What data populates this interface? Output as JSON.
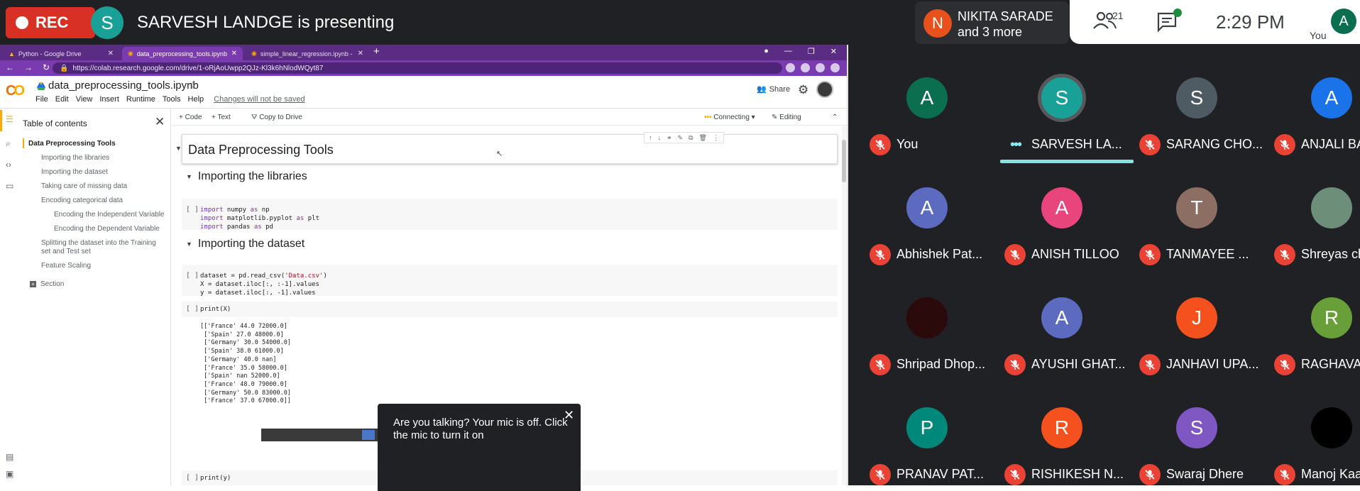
{
  "meet": {
    "rec_label": "REC",
    "presenter_initial": "S",
    "presenting_text": "SARVESH LANDGE is presenting",
    "others_initial": "N",
    "others_line1": "NIKITA SARADE",
    "others_line2": "and 3 more",
    "people_count": "21",
    "time": "2:29  PM",
    "you_label": "You",
    "you_initial": "A",
    "colors": {
      "rec": "#d93025",
      "speaking_bar": "#81e5e0",
      "mute": "#ea4335"
    }
  },
  "browser": {
    "tabs": [
      {
        "label": "Python - Google Drive"
      },
      {
        "label": "data_preprocessing_tools.ipynb"
      },
      {
        "label": "simple_linear_regression.ipynb -"
      }
    ],
    "url": "https://colab.research.google.com/drive/1-oRjAoUwpp2QJz-Kl3k6hNlodWQyt87"
  },
  "colab": {
    "logo": "CO",
    "notebook_title": "data_preprocessing_tools.ipynb",
    "menu": [
      "File",
      "Edit",
      "View",
      "Insert",
      "Runtime",
      "Tools",
      "Help"
    ],
    "unsaved": "Changes will not be saved",
    "share": "Share",
    "toolbar": {
      "code": "+ Code",
      "text": "+ Text",
      "copy": "Copy to Drive",
      "connecting": "Connecting",
      "editing": "Editing"
    },
    "toc": {
      "title": "Table of contents",
      "items": [
        "Data Preprocessing Tools",
        "Importing the libraries",
        "Importing the dataset",
        "Taking care of missing data",
        "Encoding categorical data",
        "Encoding the Independent Variable",
        "Encoding the Dependent Variable",
        "Splitting the dataset into the Training",
        "set and Test set",
        "Feature Scaling",
        "Section"
      ]
    },
    "headings": {
      "h1": "Data Preprocessing Tools",
      "h2a": "Importing the libraries",
      "h2b": "Importing the dataset"
    },
    "run_bracket": "[ ]",
    "cell1": [
      {
        "kw": "import",
        "rest": " numpy ",
        "kw2": "as",
        "rest2": " np"
      },
      {
        "kw": "import",
        "rest": " matplotlib.pyplot ",
        "kw2": "as",
        "rest2": " plt"
      },
      {
        "kw": "import",
        "rest": " pandas ",
        "kw2": "as",
        "rest2": " pd"
      }
    ],
    "cell2": {
      "l1a": "dataset = pd.read_csv(",
      "l1s": "'Data.csv'",
      "l1b": ")",
      "l2": "X = dataset.iloc[:, :-1].values",
      "l3": "y = dataset.iloc[:, -1].values"
    },
    "cell3": "print(X)",
    "output": [
      "[['France' 44.0 72000.0]",
      " ['Spain' 27.0 48000.0]",
      " ['Germany' 30.0 54000.0]",
      " ['Spain' 38.0 61000.0]",
      " ['Germany' 40.0 nan]",
      " ['France' 35.0 58000.0]",
      " ['Spain' nan 52000.0]",
      " ['France' 48.0 79000.0]",
      " ['Germany' 50.0 83000.0]",
      " ['France' 37.0 67000.0]]"
    ],
    "cell4": "print(y)"
  },
  "toast": {
    "text": "Are you talking? Your mic is off. Click the mic to turn it on"
  },
  "participants": [
    {
      "name": "You",
      "initial": "A",
      "color": "#0b6e4f",
      "muted": true
    },
    {
      "name": "SARVESH LA...",
      "initial": "S",
      "color": "#1aa197",
      "muted": false,
      "speaking": true
    },
    {
      "name": "SARANG CHO...",
      "initial": "S",
      "color": "#4f5b62",
      "muted": true
    },
    {
      "name": "ANJALI BANE",
      "initial": "A",
      "color": "#1a73e8",
      "muted": true
    },
    {
      "name": "Abhishek Pat...",
      "initial": "A",
      "color": "#5c6bc0",
      "muted": true
    },
    {
      "name": "ANISH TILLOO",
      "initial": "A",
      "color": "#e8457c",
      "muted": true
    },
    {
      "name": "TANMAYEE ...",
      "initial": "T",
      "color": "#8d6e63",
      "muted": true
    },
    {
      "name": "Shreyas chim",
      "initial": "",
      "color": "#6d8f7a",
      "muted": true,
      "photo": true
    },
    {
      "name": "Shripad Dhop...",
      "initial": "",
      "color": "#2a0a0a",
      "muted": true,
      "photo": true
    },
    {
      "name": "AYUSHI GHAT...",
      "initial": "A",
      "color": "#5c6bc0",
      "muted": true
    },
    {
      "name": "JANHAVI UPA...",
      "initial": "J",
      "color": "#f4511e",
      "muted": true
    },
    {
      "name": "RAGHAVAN N",
      "initial": "R",
      "color": "#689f38",
      "muted": true
    },
    {
      "name": "PRANAV PAT...",
      "initial": "P",
      "color": "#00897b",
      "muted": true
    },
    {
      "name": "RISHIKESH N...",
      "initial": "R",
      "color": "#f4511e",
      "muted": true
    },
    {
      "name": "Swaraj Dhere",
      "initial": "S",
      "color": "#7e57c2",
      "muted": true
    },
    {
      "name": "Manoj Kaakade",
      "initial": "",
      "color": "#000000",
      "muted": true,
      "photo": true
    }
  ]
}
